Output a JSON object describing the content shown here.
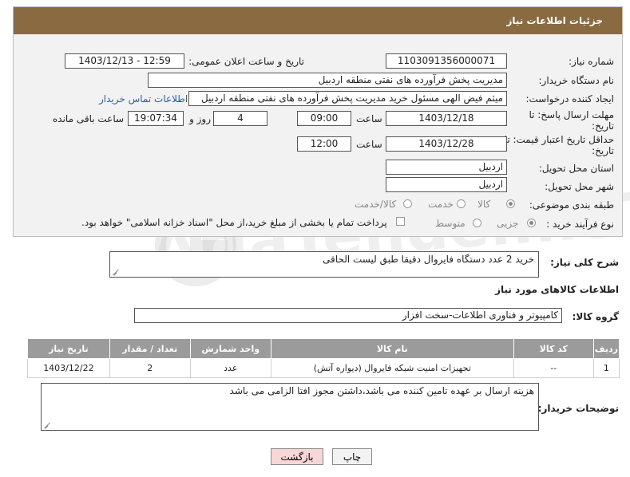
{
  "header": {
    "title": "جزئیات اطلاعات نیاز"
  },
  "fields": {
    "need_number": {
      "label": "شماره نیاز:",
      "value": "1103091356000071"
    },
    "announce": {
      "label": "تاریخ و ساعت اعلان عمومی:",
      "value": "1403/12/13 - 12:59"
    },
    "buyer_org": {
      "label": "نام دستگاه خریدار:",
      "value": "مدیریت پخش فرآورده های نفتی منطقه اردبیل"
    },
    "creator": {
      "label": "ایجاد کننده درخواست:",
      "value": "میثم فیض الهی مسئول خرید مدیریت پخش فرآورده های نفتی منطقه اردبیل",
      "contact_link": "اطلاعات تماس خریدار"
    },
    "reply_deadline": {
      "label_line1": "مهلت ارسال پاسخ: تا",
      "label_line2": "تاریخ:",
      "date": "1403/12/18",
      "time_label": "ساعت",
      "time": "09:00",
      "days": "4",
      "days_label": "روز و",
      "remaining": "19:07:34",
      "remaining_label": "ساعت باقی مانده"
    },
    "price_validity": {
      "label_line1": "حداقل تاریخ اعتبار قیمت: تا",
      "label_line2": "تاریخ:",
      "date": "1403/12/28",
      "time_label": "ساعت",
      "time": "12:00"
    },
    "province": {
      "label": "استان محل تحویل:",
      "value": "اردبیل"
    },
    "city": {
      "label": "شهر محل تحویل:",
      "value": "اردبیل"
    },
    "category": {
      "label": "طبقه بندی موضوعی:",
      "options": [
        "کالا",
        "خدمت",
        "کالا/خدمت"
      ],
      "selected": "کالا"
    },
    "process": {
      "label": "نوع فرآیند خرید :",
      "options": [
        "جزیی",
        "متوسط"
      ],
      "selected": "جزیی",
      "payment_note": "پرداخت تمام یا بخشی از مبلغ خرید،از محل \"اسناد خزانه اسلامی\" خواهد بود."
    }
  },
  "description": {
    "label": "شرح کلی نیاز:",
    "value": "خرید 2 عدد دستگاه فایروال دقیقا طبق لیست الحاقی"
  },
  "goods_section": {
    "title": "اطلاعات کالاهای مورد نیاز"
  },
  "goods_group": {
    "label": "گروه کالا:",
    "value": "کامپیوتر و فناوری اطلاعات-سخت افزار"
  },
  "table": {
    "headers": [
      "ردیف",
      "کد کالا",
      "نام کالا",
      "واحد شمارش",
      "تعداد / مقدار",
      "تاریخ نیاز"
    ],
    "rows": [
      [
        "1",
        "--",
        "تجهیزات امنیت شبکه فایروال (دیواره آتش)",
        "عدد",
        "2",
        "1403/12/22"
      ]
    ]
  },
  "buyer_notes": {
    "label": "توضیحات خریدار:",
    "value": "هزینه ارسال بر عهده تامین کننده می باشد،داشتن مجوز افتا الزامی می باشد"
  },
  "buttons": {
    "print": "چاپ",
    "back": "بازگشت"
  },
  "watermark_text": "AriaTender.neT",
  "colors": {
    "header_bg": "#8a6a40",
    "table_header_bg": "#9b9b9b",
    "link": "#2a5db0",
    "back_button_bg": "#f7d6d6"
  }
}
